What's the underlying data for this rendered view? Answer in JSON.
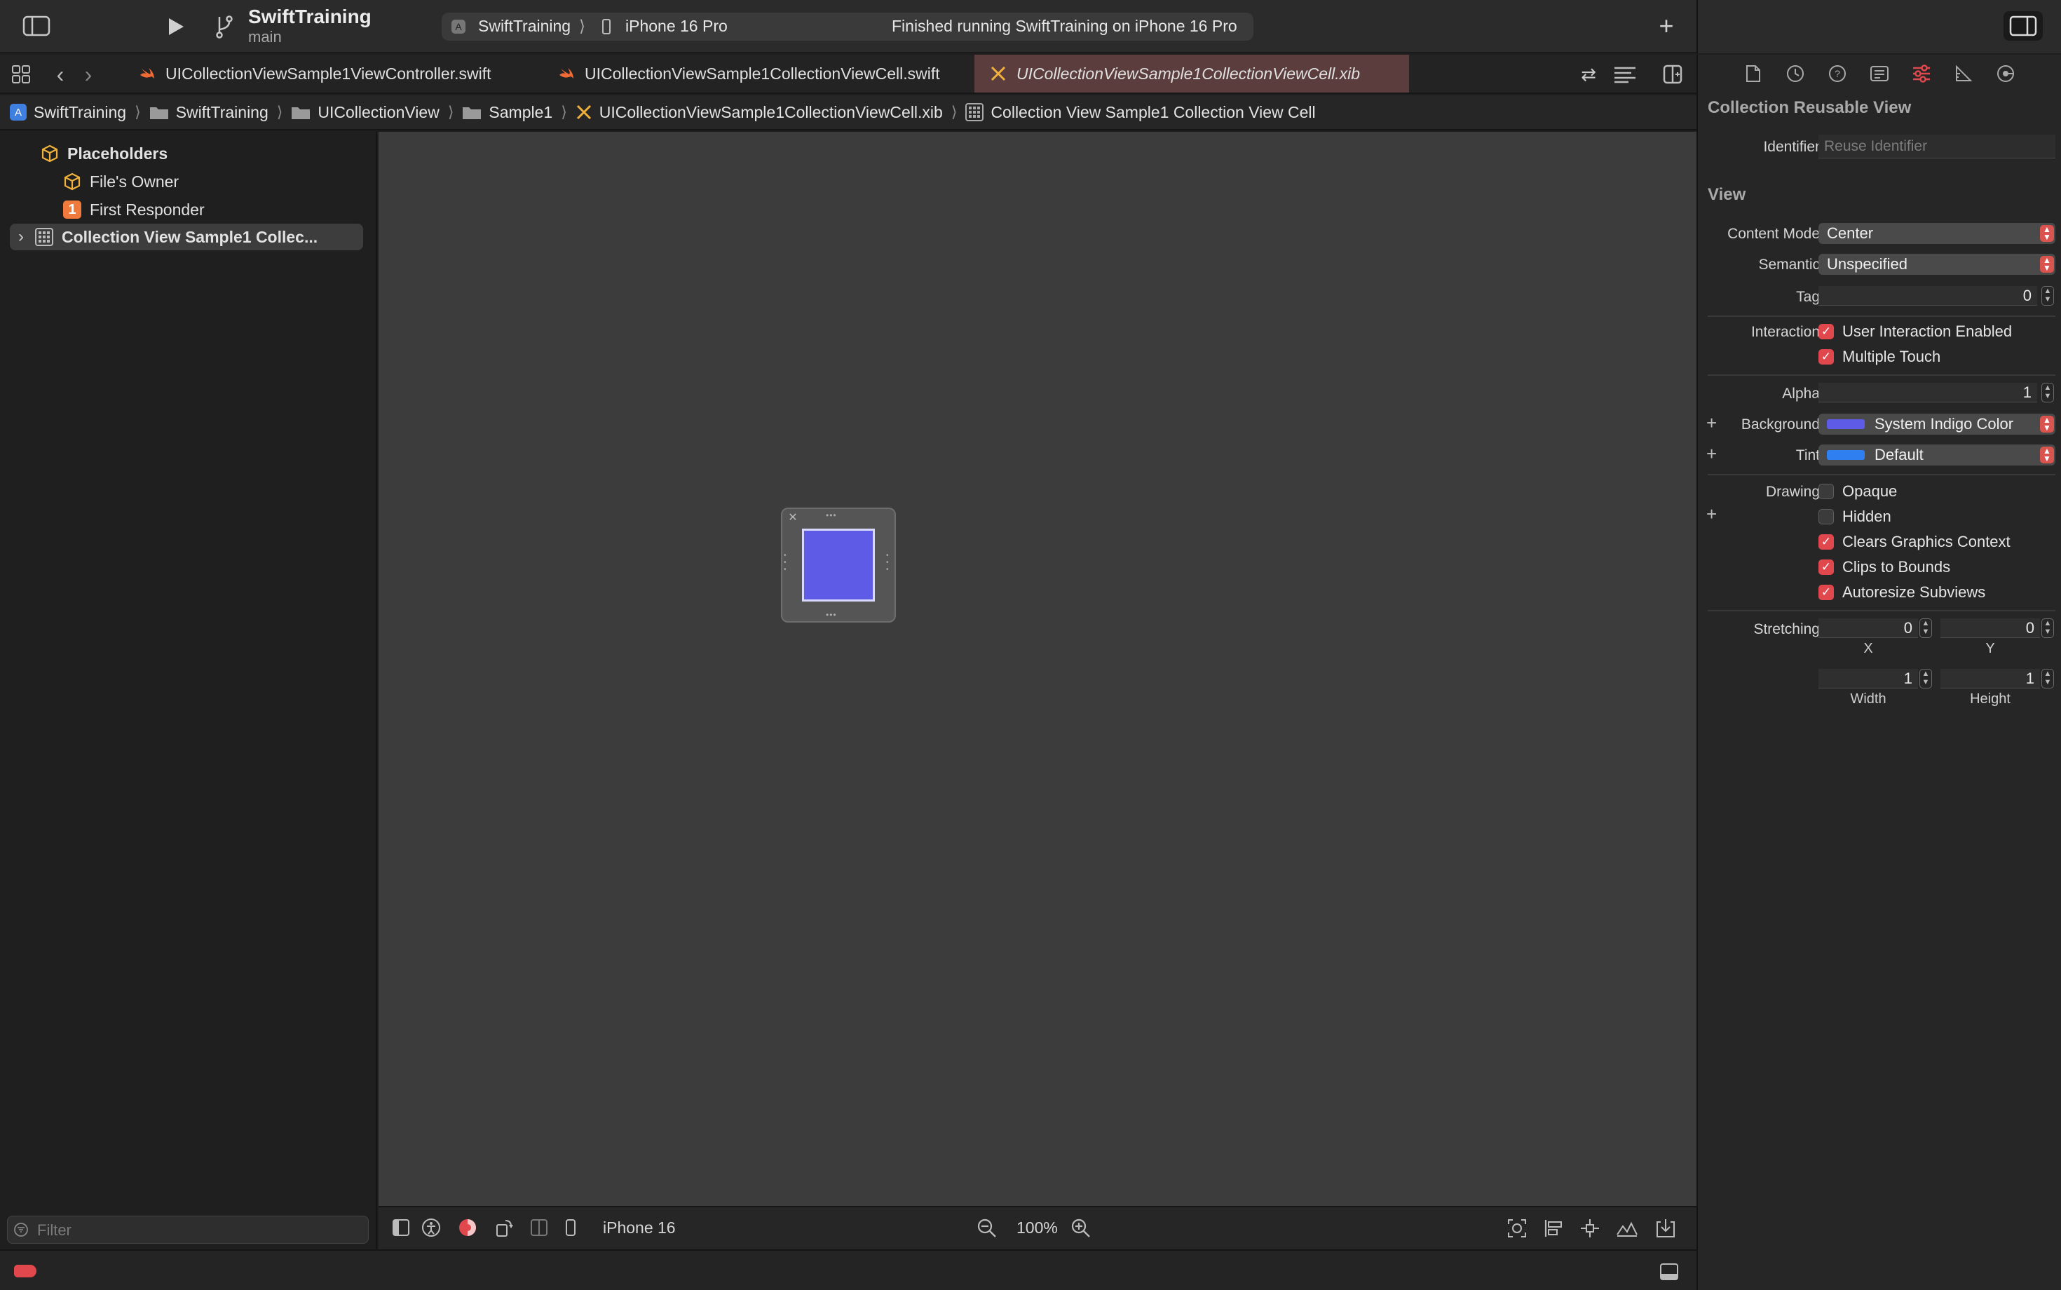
{
  "toolbar": {
    "project_name": "SwiftTraining",
    "branch": "main",
    "scheme": "SwiftTraining",
    "device": "iPhone 16 Pro",
    "status": "Finished running SwiftTraining on iPhone 16 Pro"
  },
  "tabs": [
    {
      "label": "UICollectionViewSample1ViewController.swift",
      "icon": "swift-icon"
    },
    {
      "label": "UICollectionViewSample1CollectionViewCell.swift",
      "icon": "swift-icon"
    },
    {
      "label": "UICollectionViewSample1CollectionViewCell.xib",
      "icon": "xib-icon",
      "active": true
    }
  ],
  "breadcrumb": [
    "SwiftTraining",
    "SwiftTraining",
    "UICollectionView",
    "Sample1",
    "UICollectionViewSample1CollectionViewCell.xib",
    "Collection View Sample1 Collection View Cell"
  ],
  "navigator": {
    "placeholders": "Placeholders",
    "files_owner": "File's Owner",
    "first_responder": "First Responder",
    "cell_item": "Collection View Sample1 Collec...",
    "filter_placeholder": "Filter"
  },
  "canvas_bar": {
    "device": "iPhone 16",
    "zoom": "100%"
  },
  "inspector": {
    "section_reusable": "Collection Reusable View",
    "identifier_label": "Identifier",
    "identifier_placeholder": "Reuse Identifier",
    "section_view": "View",
    "content_mode_label": "Content Mode",
    "content_mode": "Center",
    "semantic_label": "Semantic",
    "semantic": "Unspecified",
    "tag_label": "Tag",
    "tag": "0",
    "interaction_label": "Interaction",
    "user_interaction": "User Interaction Enabled",
    "multiple_touch": "Multiple Touch",
    "alpha_label": "Alpha",
    "alpha": "1",
    "background_label": "Background",
    "background": "System Indigo Color",
    "background_color": "#5e5ce6",
    "tint_label": "Tint",
    "tint": "Default",
    "tint_color": "#2f7ff0",
    "drawing_label": "Drawing",
    "opaque": "Opaque",
    "hidden": "Hidden",
    "clears_graphics": "Clears Graphics Context",
    "clips_to_bounds": "Clips to Bounds",
    "autoresize": "Autoresize Subviews",
    "stretching_label": "Stretching",
    "stretch_x": "0",
    "stretch_y": "0",
    "x_caption": "X",
    "y_caption": "Y",
    "stretch_w": "1",
    "stretch_h": "1",
    "width_caption": "Width",
    "height_caption": "Height"
  }
}
